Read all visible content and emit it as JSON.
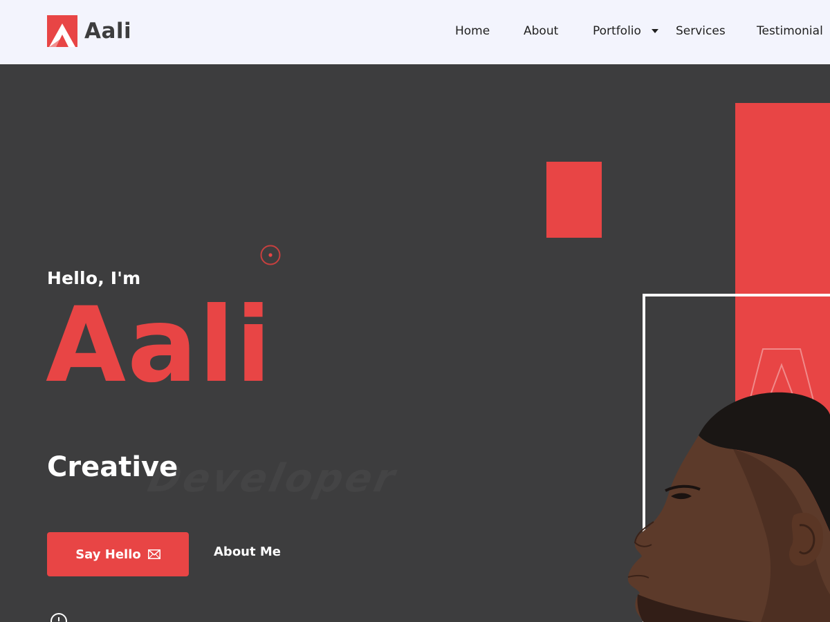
{
  "header": {
    "brand": "Aali",
    "nav": {
      "home": "Home",
      "about": "About",
      "portfolio": "Portfolio",
      "services": "Services",
      "testimonial": "Testimonial"
    }
  },
  "hero": {
    "greeting": "Hello, I'm",
    "name": "Aali",
    "role": "Creative",
    "ghost_word": "Developer",
    "buttons": {
      "primary": "Say Hello",
      "secondary": "About Me"
    }
  },
  "icons": {
    "logo": "brand-a-logo",
    "caret": "caret-down-icon",
    "mail": "envelope-icon",
    "target": "target-circle-icon",
    "scroll": "scroll-indicator-icon"
  },
  "colors": {
    "accent": "#e84545",
    "dark_bg": "#3d3d3e",
    "header_bg": "#f3f4fd",
    "text_light": "#ffffff",
    "text_dark": "#1f1f1f"
  }
}
